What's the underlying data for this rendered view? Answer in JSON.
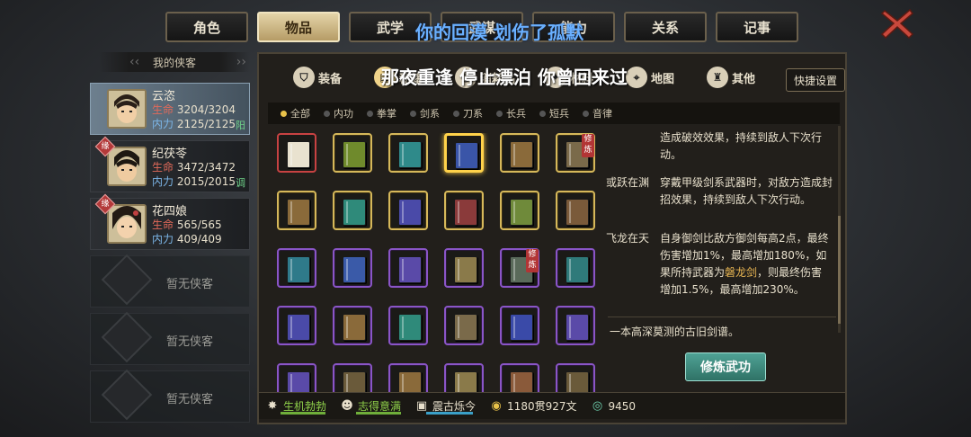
{
  "top_tabs": [
    {
      "label": "角色",
      "active": false
    },
    {
      "label": "物品",
      "active": true
    },
    {
      "label": "武学",
      "active": false
    },
    {
      "label": "武谋",
      "active": false
    },
    {
      "label": "能力",
      "active": false
    },
    {
      "label": "关系",
      "active": false
    },
    {
      "label": "记事",
      "active": false
    }
  ],
  "overlay_top": "你的回漠 划伤了孤默",
  "overlay_mid": "那夜重逢 停止漂泊 你曾回来过",
  "left_panel": {
    "title": "我的侠客",
    "characters": [
      {
        "name": "云恣",
        "hp_label": "生命",
        "hp": "3204/3204",
        "mp_label": "内力",
        "mp": "2125/2125",
        "tag": "阳",
        "fate": ""
      },
      {
        "name": "纪茯苓",
        "hp_label": "生命",
        "hp": "3472/3472",
        "mp_label": "内力",
        "mp": "2015/2015",
        "tag": "调",
        "fate": "缘"
      },
      {
        "name": "花四娘",
        "hp_label": "生命",
        "hp": "565/565",
        "mp_label": "内力",
        "mp": "409/409",
        "tag": "",
        "fate": "缘"
      }
    ],
    "empty_slots": [
      "暂无侠客",
      "暂无侠客",
      "暂无侠客"
    ]
  },
  "categories": [
    {
      "label": "装备",
      "icon": "equipment-icon"
    },
    {
      "label": "秘籍",
      "icon": "manual-icon",
      "active": true
    },
    {
      "label": "消耗品",
      "icon": "consumable-icon"
    },
    {
      "label": "材料",
      "icon": "material-icon"
    },
    {
      "label": "地图",
      "icon": "map-icon"
    },
    {
      "label": "其他",
      "icon": "other-icon"
    }
  ],
  "quick_settings": "快捷设置",
  "filters": [
    {
      "label": "全部",
      "on": true
    },
    {
      "label": "内功"
    },
    {
      "label": "拳掌"
    },
    {
      "label": "剑系"
    },
    {
      "label": "刀系"
    },
    {
      "label": "长兵"
    },
    {
      "label": "短兵"
    },
    {
      "label": "音律"
    }
  ],
  "grid_badge": "修炼",
  "effects": [
    {
      "name": "",
      "desc": "造成破效效果，持续到敌人下次行动。"
    },
    {
      "name": "或跃在渊",
      "desc": "穿戴甲级剑系武器时，对敌方造成封招效果，持续到敌人下次行动。"
    },
    {
      "name": "飞龙在天",
      "desc_a": "自身御剑比敌方御剑每高2点，最终伤害增加1%，最高增加180%，如果所持武器为",
      "desc_hl": "磐龙剑",
      "desc_b": "，则最终伤害增加1.5%，最高增加230%。"
    }
  ],
  "lore": "一本高深莫测的古旧剑谱。",
  "practice_button": "修炼武功",
  "status_bar": {
    "vitality": "生机勃勃",
    "mood": "志得意满",
    "title": "震古烁今",
    "money": "1180贯927文",
    "jade": "9450"
  },
  "colors": {
    "gold_border": "#d6b85a",
    "purple_border": "#8a55c7",
    "accent_teal": "#4fa295",
    "highlight": "#e6b452"
  }
}
